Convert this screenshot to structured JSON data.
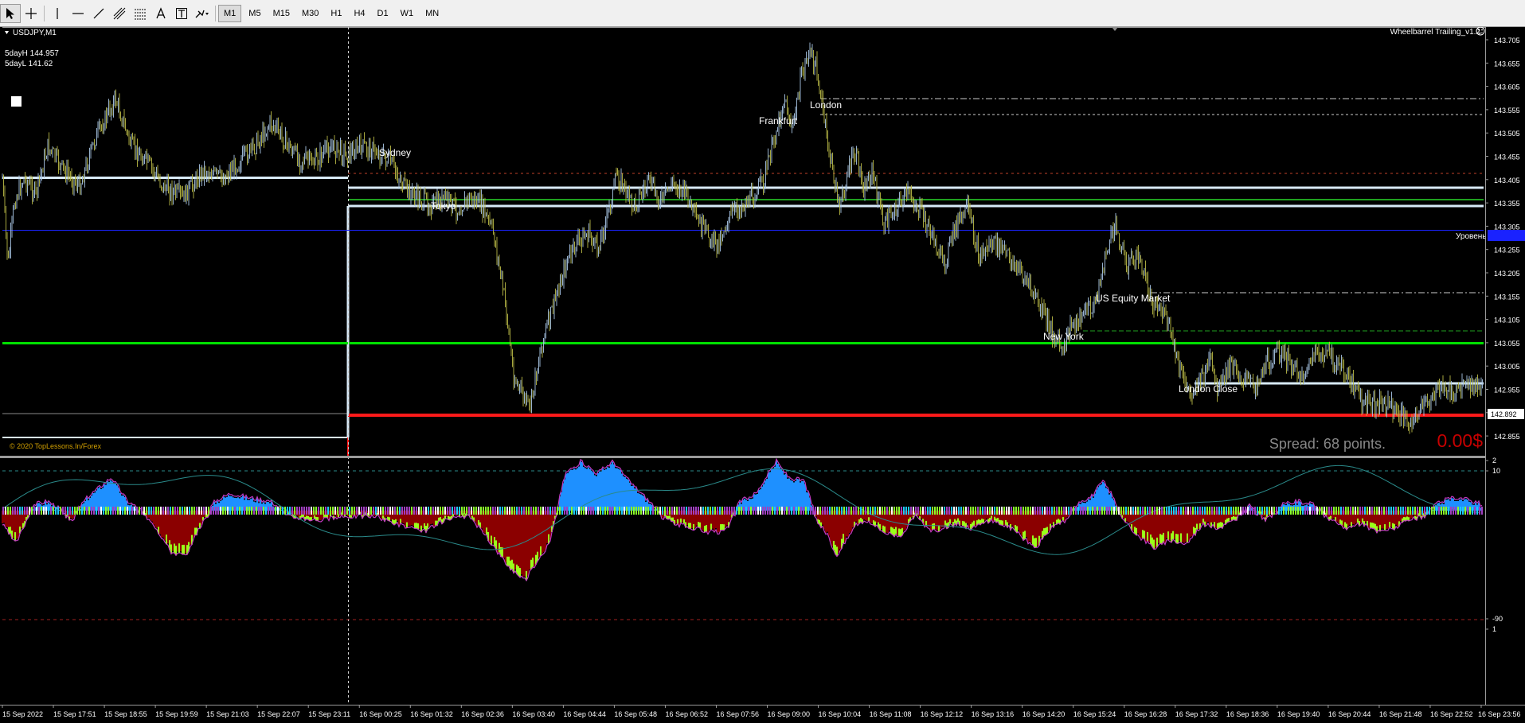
{
  "toolbar": {
    "tools": [
      {
        "name": "cursor-icon",
        "active": true
      },
      {
        "name": "crosshair-icon",
        "active": false
      },
      {
        "name": "vertical-line-icon",
        "active": false
      },
      {
        "name": "horizontal-line-icon",
        "active": false
      },
      {
        "name": "trendline-icon",
        "active": false
      },
      {
        "name": "equidistant-channel-icon",
        "active": false
      },
      {
        "name": "fibonacci-icon",
        "active": false
      },
      {
        "name": "text-icon",
        "active": false
      },
      {
        "name": "text-label-icon",
        "active": false
      },
      {
        "name": "arrows-icon",
        "active": false
      }
    ],
    "timeframes": [
      "M1",
      "M5",
      "M15",
      "M30",
      "H1",
      "H4",
      "D1",
      "W1",
      "MN"
    ],
    "active_timeframe": "M1"
  },
  "chart": {
    "symbol_label": "USDJPY,M1",
    "info_high": "5dayH 144.957",
    "info_low": "5dayL 141.62",
    "ea_name": "Wheelbarrel Trailing_v1.2",
    "copyright": "© 2020 TopLessons.In/Forex",
    "spread": "Spread: 68 points.",
    "profit": "0.00$",
    "bid_label": "142.892",
    "level_label": "Уровень",
    "price_axis": [
      "143.705",
      "143.655",
      "143.605",
      "143.555",
      "143.505",
      "143.455",
      "143.405",
      "143.355",
      "143.305",
      "143.255",
      "143.205",
      "143.155",
      "143.105",
      "143.055",
      "143.005",
      "142.955",
      "142.905",
      "142.855"
    ],
    "osc_axis": [
      "2",
      "10",
      "-90",
      "1"
    ],
    "time_axis": [
      "15 Sep 2022",
      "15 Sep 17:51",
      "15 Sep 18:55",
      "15 Sep 19:59",
      "15 Sep 21:03",
      "15 Sep 22:07",
      "15 Sep 23:11",
      "16 Sep 00:25",
      "16 Sep 01:32",
      "16 Sep 02:36",
      "16 Sep 03:40",
      "16 Sep 04:44",
      "16 Sep 05:48",
      "16 Sep 06:52",
      "16 Sep 07:56",
      "16 Sep 09:00",
      "16 Sep 10:04",
      "16 Sep 11:08",
      "16 Sep 12:12",
      "16 Sep 13:16",
      "16 Sep 14:20",
      "16 Sep 15:24",
      "16 Sep 16:28",
      "16 Sep 17:32",
      "16 Sep 18:36",
      "16 Sep 19:40",
      "16 Sep 20:44",
      "16 Sep 21:48",
      "16 Sep 22:52",
      "16 Sep 23:56"
    ],
    "sessions": [
      {
        "label": "Sydney",
        "time": "00:25"
      },
      {
        "label": "Tokyo",
        "time": "01:32"
      },
      {
        "label": "Frankfurt",
        "time": "08:40"
      },
      {
        "label": "London",
        "time": "09:30"
      },
      {
        "label": "US Equity Market",
        "time": "15:30"
      },
      {
        "label": "New York",
        "time": "14:50"
      },
      {
        "label": "London Close",
        "time": "17:30"
      }
    ],
    "colors": {
      "up": "#a9c7e6",
      "down": "#b8b846",
      "green_level": "#00e000",
      "red_level": "#ff1a1a",
      "blue_level": "#1a22ff",
      "white_level": "#d8eaf8",
      "hist_pos": "#1e90ff",
      "hist_neg": "#8b0000",
      "hist_lime": "#9aff1a",
      "osc_line": "#c23ac2",
      "signal": "#2a8a8a"
    }
  }
}
